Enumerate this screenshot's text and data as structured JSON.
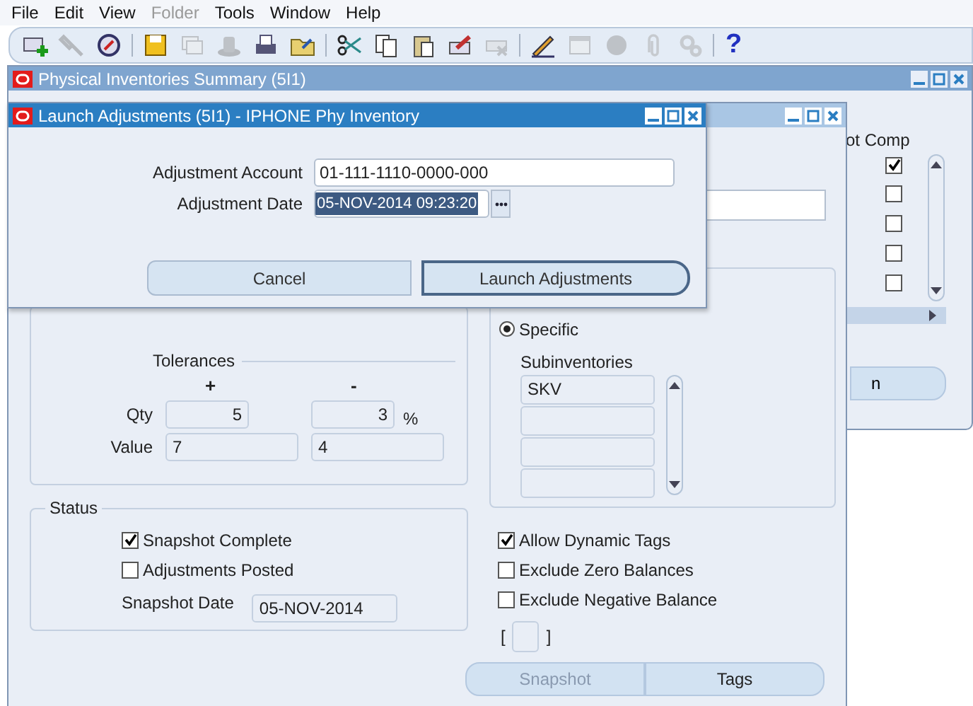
{
  "menu_bar": [
    {
      "label": "File",
      "disabled": false
    },
    {
      "label": "Edit",
      "disabled": false
    },
    {
      "label": "View",
      "disabled": false
    },
    {
      "label": "Folder",
      "disabled": true
    },
    {
      "label": "Tools",
      "disabled": false
    },
    {
      "label": "Window",
      "disabled": false
    },
    {
      "label": "Help",
      "disabled": false
    }
  ],
  "toolbar": [
    {
      "kind": "new",
      "disabled": false
    },
    {
      "kind": "flashlight",
      "disabled": true
    },
    {
      "kind": "compass",
      "disabled": false
    },
    {
      "kind": "separator"
    },
    {
      "kind": "save",
      "disabled": false
    },
    {
      "kind": "step",
      "disabled": true
    },
    {
      "kind": "hat",
      "disabled": true
    },
    {
      "kind": "print",
      "disabled": false
    },
    {
      "kind": "folder",
      "disabled": false
    },
    {
      "kind": "separator"
    },
    {
      "kind": "cut",
      "disabled": false
    },
    {
      "kind": "copy",
      "disabled": false
    },
    {
      "kind": "paste",
      "disabled": false
    },
    {
      "kind": "clear",
      "disabled": false
    },
    {
      "kind": "delete",
      "disabled": true
    },
    {
      "kind": "separator"
    },
    {
      "kind": "edit",
      "disabled": false
    },
    {
      "kind": "window",
      "disabled": true
    },
    {
      "kind": "sphere",
      "disabled": true
    },
    {
      "kind": "clip",
      "disabled": true
    },
    {
      "kind": "gears",
      "disabled": true
    },
    {
      "kind": "separator"
    },
    {
      "kind": "help",
      "disabled": false,
      "glyph": "?"
    }
  ],
  "summary_window": {
    "title": "Physical Inventories Summary (5I1)",
    "column_header": "ot Comp",
    "rows": [
      {
        "checked": true
      },
      {
        "checked": false
      },
      {
        "checked": false
      },
      {
        "checked": false
      },
      {
        "checked": false
      }
    ],
    "button_label": "n"
  },
  "inventory_window": {
    "tolerances": {
      "title": "Tolerances",
      "plus": "+",
      "minus": "-",
      "percent": "%",
      "rows": [
        {
          "label": "Qty",
          "plus": "5",
          "minus": "3",
          "kind": "qty"
        },
        {
          "label": "Value",
          "plus": "7",
          "minus": "4",
          "kind": "value"
        }
      ]
    },
    "status": {
      "title": "Status",
      "checkboxes": [
        {
          "label": "Snapshot Complete",
          "checked": true
        },
        {
          "label": "Adjustments Posted",
          "checked": false
        }
      ],
      "snapshot_date_label": "Snapshot Date",
      "snapshot_date": "05-NOV-2014"
    },
    "specific_radio": {
      "label": "Specific",
      "selected": true
    },
    "subinventories": {
      "label": "Subinventories",
      "rows": [
        "SKV"
      ]
    },
    "options": [
      {
        "label": "Allow Dynamic Tags",
        "checked": true
      },
      {
        "label": "Exclude Zero Balances",
        "checked": false
      },
      {
        "label": "Exclude Negative Balance",
        "checked": false
      }
    ],
    "bracket_open": "[",
    "bracket_close": "]",
    "buttons": [
      {
        "label": "Snapshot",
        "disabled": true
      },
      {
        "label": "Tags",
        "disabled": false
      }
    ]
  },
  "dialog": {
    "title": "Launch Adjustments (5I1) - IPHONE Phy Inventory",
    "fields": [
      {
        "label": "Adjustment Account",
        "value": "01-111-1110-0000-000",
        "selected": false,
        "kind": "text"
      },
      {
        "label": "Adjustment Date",
        "value": "05-NOV-2014 09:23:20",
        "selected": true,
        "kind": "date"
      }
    ],
    "buttons": [
      {
        "label": "Cancel",
        "default": false
      },
      {
        "label": "Launch Adjustments",
        "default": true
      }
    ]
  }
}
